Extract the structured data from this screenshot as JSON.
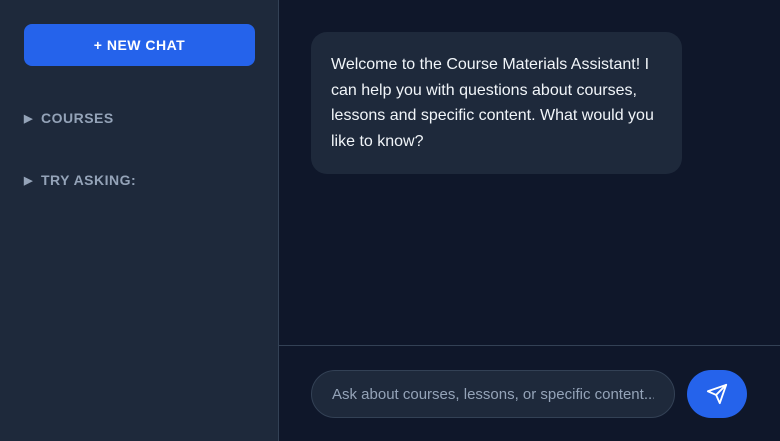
{
  "sidebar": {
    "new_chat_label": "+ NEW CHAT",
    "sections": [
      {
        "label": "COURSES",
        "icon": "triangle-right-icon"
      },
      {
        "label": "TRY ASKING:",
        "icon": "triangle-right-icon"
      }
    ]
  },
  "chat": {
    "messages": [
      {
        "role": "assistant",
        "text": "Welcome to the Course Materials Assistant! I can help you with questions about courses, lessons and specific content. What would you like to know?"
      }
    ]
  },
  "input": {
    "placeholder": "Ask about courses, lessons, or specific content...",
    "value": "",
    "send_icon": "send-icon"
  },
  "colors": {
    "background": "#0f172a",
    "sidebar": "#1e293b",
    "accent": "#2563eb",
    "text_primary": "#f1f5f9",
    "text_secondary": "#94a3b8",
    "border": "#334155"
  }
}
